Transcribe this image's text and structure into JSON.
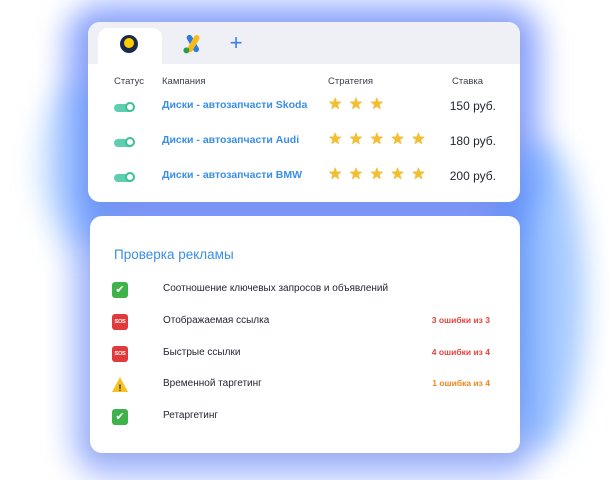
{
  "colors": {
    "accent_blue": "#3a8ee6",
    "toggle_green": "#5dcfb0",
    "star_gold": "#f4bf2a",
    "error_red": "#e4423a",
    "warning_orange": "#f0861f"
  },
  "tabs": {
    "items": [
      {
        "icon": "yandex-direct-icon",
        "active": true
      },
      {
        "icon": "google-ads-icon",
        "active": false
      }
    ],
    "add_icon": "+"
  },
  "campaigns": {
    "headers": {
      "status": "Статус",
      "campaign": "Кампания",
      "strategy": "Стратегия",
      "bid": "Ставка"
    },
    "rows": [
      {
        "enabled": true,
        "name": "Диски - автозапчасти Skoda",
        "stars": 3,
        "bid": "150 руб."
      },
      {
        "enabled": true,
        "name": "Диски - автозапчасти Audi",
        "stars": 5,
        "bid": "180 руб."
      },
      {
        "enabled": true,
        "name": "Диски - автозапчасти BMW",
        "stars": 5,
        "bid": "200 руб."
      }
    ]
  },
  "ad_check": {
    "title": "Проверка рекламы",
    "items": [
      {
        "status": "ok",
        "label": "Соотношение ключевых запросов и объявлений",
        "errors": ""
      },
      {
        "status": "sos",
        "label": "Отображаемая ссылка",
        "errors": "3 ошибки из 3"
      },
      {
        "status": "sos",
        "label": "Быстрые ссылки",
        "errors": "4 ошибки из 4"
      },
      {
        "status": "warn",
        "label": "Временной таргетинг",
        "errors": "1 ошибка из 4"
      },
      {
        "status": "ok",
        "label": "Ретаргетинг",
        "errors": ""
      }
    ],
    "sos_text": "SOS",
    "ok_mark": "✔",
    "warn_mark": "!"
  }
}
